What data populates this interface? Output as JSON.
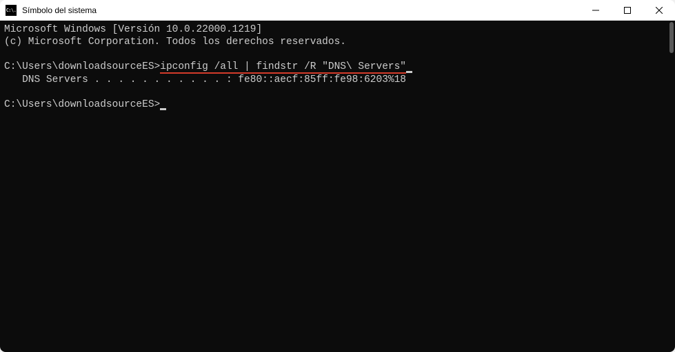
{
  "window": {
    "title": "Símbolo del sistema",
    "icon_label": "C:\\."
  },
  "terminal": {
    "banner_line1": "Microsoft Windows [Versión 10.0.22000.1219]",
    "banner_line2": "(c) Microsoft Corporation. Todos los derechos reservados.",
    "prompt1_path": "C:\\Users\\downloadsourceES>",
    "prompt1_command": "ipconfig /all | findstr /R \"DNS\\ Servers\"",
    "output_line1": "   DNS Servers . . . . . . . . . . . : fe80::aecf:85ff:fe98:6203%18",
    "prompt2_path": "C:\\Users\\downloadsourceES>"
  }
}
